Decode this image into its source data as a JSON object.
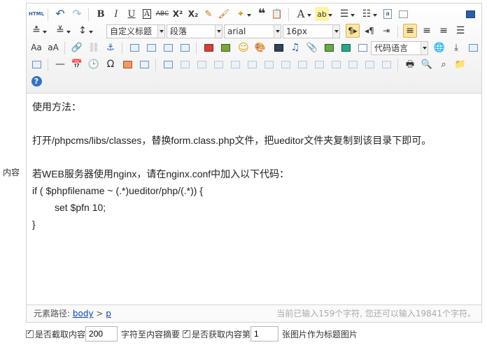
{
  "field_label": "内容",
  "toolbar": {
    "html_label": "HTML",
    "font_a_label": "A",
    "format_heading": "自定义标题",
    "format_paragraph": "段落",
    "font_family": "arial",
    "font_size": "16px",
    "code_lang": "代码语言",
    "help_label": "?"
  },
  "content": {
    "lines": [
      "使用方法：",
      "",
      "打开/phpcms/libs/classes，替换form.class.php文件，把ueditor文件夹复制到该目录下即可。",
      "",
      "若WEB服务器使用nginx，请在nginx.conf中加入以下代码：",
      "if ( $phpfilename ~ (.*)ueditor/php/(.*)) {",
      "set $pfn 10;",
      "}"
    ]
  },
  "statusbar": {
    "path_label": "元素路径:",
    "path_body": "body",
    "path_sep": ">",
    "path_p": "p",
    "word_count": "当前已输入159个字符, 您还可以输入19841个字符。"
  },
  "options": {
    "intercept_label": "是否截取内容",
    "intercept_value": "200",
    "intercept_suffix": "字符至内容摘要",
    "thumb_label": "是否获取内容第",
    "thumb_value": "1",
    "thumb_suffix": "张图片作为标题图片"
  }
}
